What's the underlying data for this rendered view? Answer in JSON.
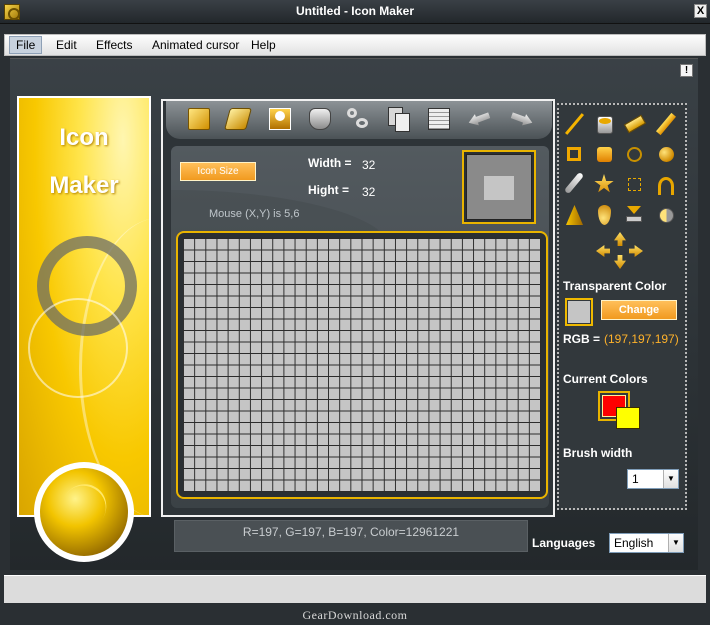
{
  "window": {
    "title": "Untitled - Icon Maker",
    "close_glyph": "X"
  },
  "menu": {
    "items": [
      {
        "label": "File"
      },
      {
        "label": "Edit"
      },
      {
        "label": "Effects"
      },
      {
        "label": "Animated cursor"
      },
      {
        "label": "Help"
      }
    ]
  },
  "info_glyph": "!",
  "banner": {
    "title_line1": "Icon",
    "title_line2": "Maker"
  },
  "toolbar": {
    "icons": [
      "new-icon",
      "open-icon",
      "save-icon",
      "import-icon",
      "cut-icon",
      "copy-icon",
      "paste-icon",
      "undo-icon",
      "redo-icon"
    ]
  },
  "canvas": {
    "icon_size_label": "Icon Size",
    "width_label": "Width =",
    "width_value": "32",
    "height_label": "Hight =",
    "height_value": "32",
    "mouse_text": "Mouse (X,Y) is 5,6",
    "grid_cols": 32,
    "grid_rows": 22
  },
  "tools": {
    "icons": [
      "line-icon",
      "bucket-fill-icon",
      "eraser-icon",
      "pencil-icon",
      "rectangle-outline-icon",
      "rectangle-filled-icon",
      "ellipse-outline-icon",
      "ellipse-filled-icon",
      "color-picker-icon",
      "star-icon",
      "selection-icon",
      "curve-icon",
      "cone-icon",
      "drop-icon",
      "stamp-icon",
      "sphere-icon"
    ]
  },
  "transparent_color": {
    "label": "Transparent Color",
    "change_label": "Change",
    "rgb_label": "RGB =",
    "rgb_value": "(197,197,197)",
    "swatch": "#c5c5c5"
  },
  "current_colors": {
    "label": "Current Colors",
    "primary": "#ff0000",
    "secondary": "#ffff00"
  },
  "brush": {
    "label": "Brush width",
    "value": "1"
  },
  "status": {
    "text": "R=197, G=197, B=197, Color=12961221"
  },
  "language": {
    "label": "Languages",
    "value": "English"
  },
  "watermark": "GearDownload.com"
}
